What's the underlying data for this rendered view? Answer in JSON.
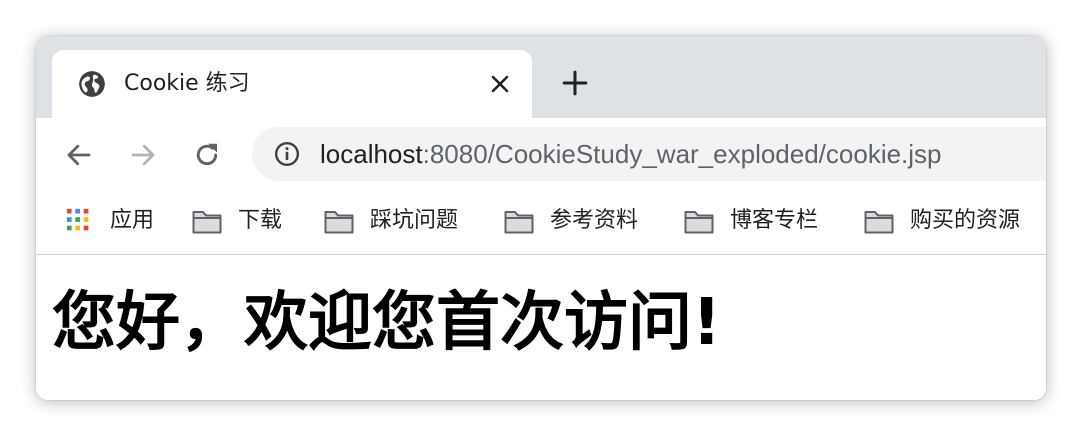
{
  "tab": {
    "favicon": "globe-icon",
    "title": "Cookie 练习",
    "close_icon": "close-icon",
    "new_tab_icon": "plus-icon"
  },
  "toolbar": {
    "back_icon": "arrow-left-icon",
    "forward_icon": "arrow-right-icon",
    "reload_icon": "reload-icon",
    "info_icon": "info-icon",
    "url_host": "localhost",
    "url_path": ":8080/CookieStudy_war_exploded/cookie.jsp"
  },
  "bookmarks": {
    "items": [
      {
        "label": "应用",
        "icon": "apps-grid-icon"
      },
      {
        "label": "下载",
        "icon": "folder-icon"
      },
      {
        "label": "踩坑问题",
        "icon": "folder-icon"
      },
      {
        "label": "参考资料",
        "icon": "folder-icon"
      },
      {
        "label": "博客专栏",
        "icon": "folder-icon"
      },
      {
        "label": "购买的资源",
        "icon": "folder-icon"
      }
    ]
  },
  "page": {
    "headline": "您好，欢迎您首次访问!"
  },
  "colors": {
    "tabstrip_bg": "#dee1e6",
    "omnibox_bg": "#f1f3f4",
    "text": "#202124",
    "muted": "#5f6368"
  }
}
